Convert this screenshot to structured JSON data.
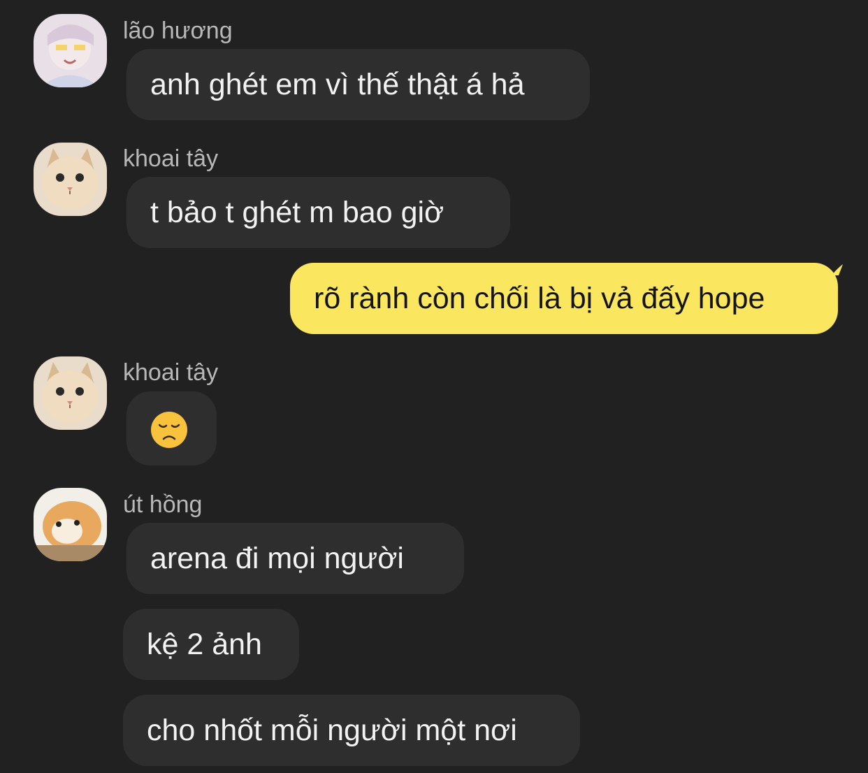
{
  "messages": [
    {
      "sender": "lão hương",
      "text": "anh ghét em vì thế thật á hả",
      "avatar": "anime-girl-avatar"
    },
    {
      "sender": "khoai tây",
      "text": "t bảo t ghét m bao giờ",
      "avatar": "cat-avatar"
    },
    {
      "sender": "",
      "text": "rõ rành còn chối là bị vả đấy hope",
      "mine": true
    },
    {
      "sender": "khoai tây",
      "text": "😞",
      "avatar": "cat-avatar",
      "emoji": "disappointed-face"
    },
    {
      "sender": "út hồng",
      "text": "arena đi mọi người",
      "avatar": "orange-cat-avatar"
    },
    {
      "sender": "",
      "text": "kệ 2 ảnh"
    },
    {
      "sender": "",
      "text": "cho nhốt mỗi người một nơi"
    }
  ],
  "colors": {
    "background": "#212121",
    "bubble_other": "#2e2e2e",
    "bubble_mine": "#fae75f",
    "sender_name": "#b8b8b8"
  }
}
